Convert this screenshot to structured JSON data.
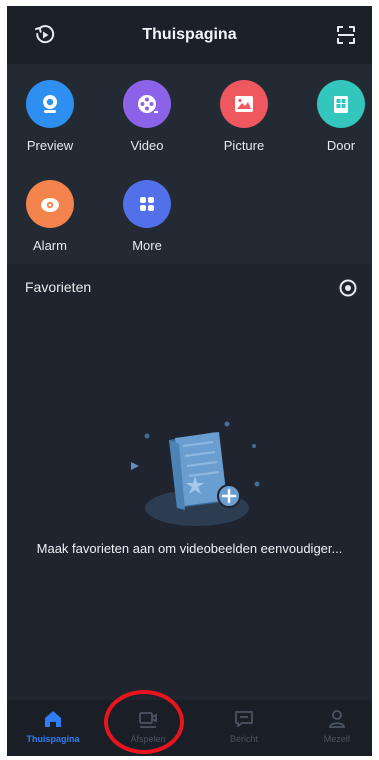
{
  "header": {
    "title": "Thuispagina",
    "left_icon": "playback-icon",
    "right_icon": "scan-icon"
  },
  "menu": {
    "items": [
      {
        "label": "Preview",
        "icon": "camera-icon",
        "color": "#2f8ff0"
      },
      {
        "label": "Video",
        "icon": "film-reel-icon",
        "color": "#8c63e8"
      },
      {
        "label": "Picture",
        "icon": "picture-icon",
        "color": "#f0585f"
      },
      {
        "label": "Door",
        "icon": "door-icon",
        "color": "#32c6bd"
      },
      {
        "label": "Alarm",
        "icon": "alarm-icon",
        "color": "#f5834d"
      },
      {
        "label": "More",
        "icon": "more-icon",
        "color": "#5270ea"
      }
    ]
  },
  "favorites": {
    "title": "Favorieten",
    "empty_message": "Maak favorieten aan om videobeelden eenvoudiger..."
  },
  "bottom_nav": {
    "items": [
      {
        "label": "Thuispagina",
        "icon": "home-icon",
        "active": true
      },
      {
        "label": "Afspelen",
        "icon": "playback-video-icon",
        "active": false
      },
      {
        "label": "Bericht",
        "icon": "message-icon",
        "active": false
      },
      {
        "label": "Mezelf",
        "icon": "profile-icon",
        "active": false
      }
    ]
  },
  "colors": {
    "background": "#1f242e",
    "panel": "#242a34",
    "active_tab": "#2e7df6",
    "inactive_tab": "#4b5463",
    "highlight": "#e8141e"
  }
}
